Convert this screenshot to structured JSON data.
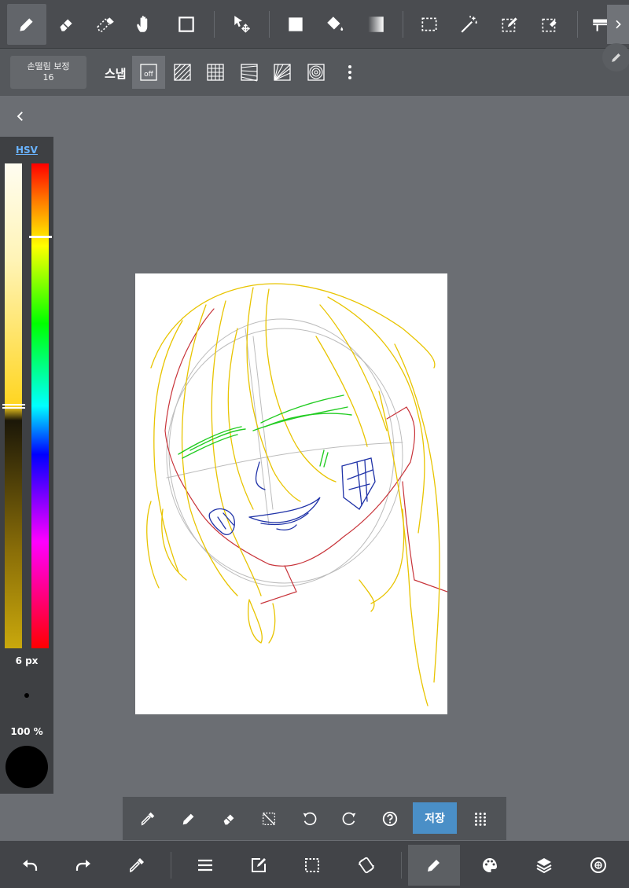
{
  "top_toolbar": {
    "tools": [
      {
        "name": "brush",
        "icon": "pencil-icon",
        "active": true
      },
      {
        "name": "eraser",
        "icon": "eraser-icon"
      },
      {
        "name": "blur-eraser",
        "icon": "dotted-eraser-icon"
      },
      {
        "name": "hand",
        "icon": "hand-icon"
      },
      {
        "name": "shape",
        "icon": "square-outline-icon"
      },
      {
        "name": "move",
        "icon": "move-cursor-icon"
      },
      {
        "name": "fill-rect",
        "icon": "filled-square-icon"
      },
      {
        "name": "bucket",
        "icon": "paint-bucket-icon"
      },
      {
        "name": "gradient",
        "icon": "gradient-icon"
      },
      {
        "name": "select-rect",
        "icon": "dashed-rect-icon"
      },
      {
        "name": "magic-wand",
        "icon": "magic-wand-icon"
      },
      {
        "name": "select-pen",
        "icon": "select-pen-icon"
      },
      {
        "name": "select-eraser",
        "icon": "select-eraser-icon"
      },
      {
        "name": "text",
        "icon": "text-tool-icon"
      }
    ]
  },
  "sub_toolbar": {
    "stabilizer_line1": "손떨림 보정",
    "stabilizer_line2": "16",
    "snap_label": "스냅",
    "snap_off_label": "off",
    "snap_options": [
      "parallel-snap-icon",
      "grid-snap-icon",
      "perspective-snap-icon",
      "radial-snap-icon",
      "circle-snap-icon"
    ]
  },
  "color_panel": {
    "mode_label": "HSV",
    "brush_size": "6 px",
    "opacity": "100 %",
    "current_color": "#000000",
    "hue_level": 0.15,
    "brightness_level": 0.5
  },
  "quick_bar": {
    "save_label": "저장",
    "tools": [
      "eyedropper-icon",
      "pencil-icon",
      "eraser-icon",
      "deselect-icon",
      "undo-rotate-icon",
      "redo-rotate-icon",
      "help-icon"
    ]
  },
  "bottom_bar": {
    "tools": [
      "undo-icon",
      "redo-icon",
      "eyedropper-icon",
      "menu-icon",
      "edit-icon",
      "selection-icon",
      "rotate-canvas-icon",
      "brush-icon",
      "palette-icon",
      "layers-icon",
      "material-icon"
    ],
    "active": "brush-icon"
  },
  "colors": {
    "accent": "#4a8fc7",
    "sketch_yellow": "#e8c400",
    "sketch_red": "#c8343a",
    "sketch_green": "#22cc22",
    "sketch_blue": "#2033a8",
    "sketch_gray": "#bcbcbc"
  }
}
